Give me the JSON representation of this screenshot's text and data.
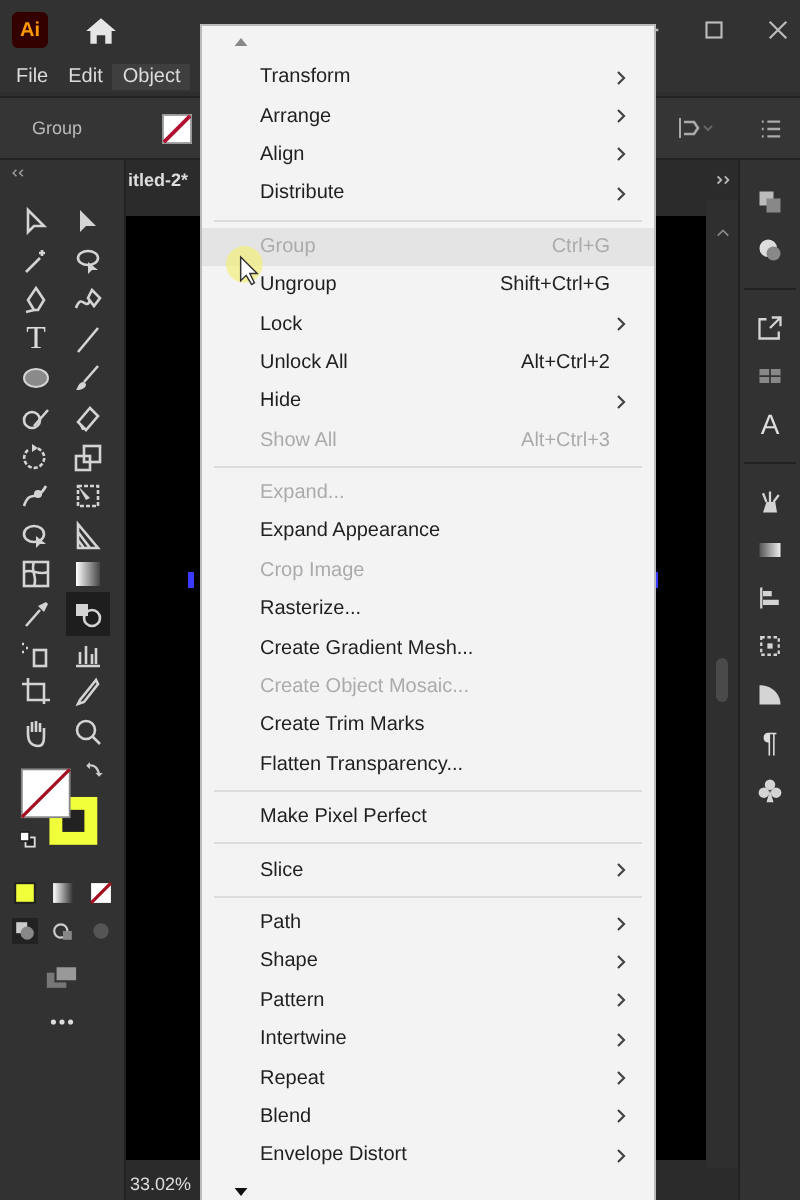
{
  "app_bar": {
    "logo": "Ai"
  },
  "menu_bar": [
    {
      "label": "File",
      "selected": false
    },
    {
      "label": "Edit",
      "selected": false
    },
    {
      "label": "Object",
      "selected": true
    }
  ],
  "control_bar": {
    "selection_label": "Group"
  },
  "tools": {
    "type_tool": "T"
  },
  "document": {
    "tab_title": "itled-2*",
    "zoom": "33.02%"
  },
  "right_panel": {
    "character_glyph": "A",
    "paragraph_glyph": "¶"
  },
  "object_menu": {
    "items": [
      {
        "kind": "item",
        "label": "Transform",
        "submenu": true,
        "disabled": false,
        "hovered": false
      },
      {
        "kind": "item",
        "label": "Arrange",
        "submenu": true,
        "disabled": false,
        "hovered": false
      },
      {
        "kind": "item",
        "label": "Align",
        "submenu": true,
        "disabled": false,
        "hovered": false
      },
      {
        "kind": "item",
        "label": "Distribute",
        "submenu": true,
        "disabled": false,
        "hovered": false
      },
      {
        "kind": "separator"
      },
      {
        "kind": "item",
        "label": "Group",
        "shortcut": "Ctrl+G",
        "submenu": false,
        "disabled": true,
        "hovered": true
      },
      {
        "kind": "item",
        "label": "Ungroup",
        "shortcut": "Shift+Ctrl+G",
        "submenu": false,
        "disabled": false,
        "hovered": false
      },
      {
        "kind": "item",
        "label": "Lock",
        "submenu": true,
        "disabled": false,
        "hovered": false
      },
      {
        "kind": "item",
        "label": "Unlock All",
        "shortcut": "Alt+Ctrl+2",
        "submenu": false,
        "disabled": false,
        "hovered": false
      },
      {
        "kind": "item",
        "label": "Hide",
        "submenu": true,
        "disabled": false,
        "hovered": false
      },
      {
        "kind": "item",
        "label": "Show All",
        "shortcut": "Alt+Ctrl+3",
        "submenu": false,
        "disabled": true,
        "hovered": false
      },
      {
        "kind": "separator"
      },
      {
        "kind": "item",
        "label": "Expand...",
        "submenu": false,
        "disabled": true,
        "hovered": false
      },
      {
        "kind": "item",
        "label": "Expand Appearance",
        "submenu": false,
        "disabled": false,
        "hovered": false
      },
      {
        "kind": "item",
        "label": "Crop Image",
        "submenu": false,
        "disabled": true,
        "hovered": false
      },
      {
        "kind": "item",
        "label": "Rasterize...",
        "submenu": false,
        "disabled": false,
        "hovered": false
      },
      {
        "kind": "item",
        "label": "Create Gradient Mesh...",
        "submenu": false,
        "disabled": false,
        "hovered": false
      },
      {
        "kind": "item",
        "label": "Create Object Mosaic...",
        "submenu": false,
        "disabled": true,
        "hovered": false
      },
      {
        "kind": "item",
        "label": "Create Trim Marks",
        "submenu": false,
        "disabled": false,
        "hovered": false
      },
      {
        "kind": "item",
        "label": "Flatten Transparency...",
        "submenu": false,
        "disabled": false,
        "hovered": false
      },
      {
        "kind": "separator"
      },
      {
        "kind": "item",
        "label": "Make Pixel Perfect",
        "submenu": false,
        "disabled": false,
        "hovered": false
      },
      {
        "kind": "separator"
      },
      {
        "kind": "item",
        "label": "Slice",
        "submenu": true,
        "disabled": false,
        "hovered": false
      },
      {
        "kind": "separator"
      },
      {
        "kind": "item",
        "label": "Path",
        "submenu": true,
        "disabled": false,
        "hovered": false
      },
      {
        "kind": "item",
        "label": "Shape",
        "submenu": true,
        "disabled": false,
        "hovered": false
      },
      {
        "kind": "item",
        "label": "Pattern",
        "submenu": true,
        "disabled": false,
        "hovered": false
      },
      {
        "kind": "item",
        "label": "Intertwine",
        "submenu": true,
        "disabled": false,
        "hovered": false
      },
      {
        "kind": "item",
        "label": "Repeat",
        "submenu": true,
        "disabled": false,
        "hovered": false
      },
      {
        "kind": "item",
        "label": "Blend",
        "submenu": true,
        "disabled": false,
        "hovered": false
      },
      {
        "kind": "item",
        "label": "Envelope Distort",
        "submenu": true,
        "disabled": false,
        "hovered": false
      }
    ]
  }
}
